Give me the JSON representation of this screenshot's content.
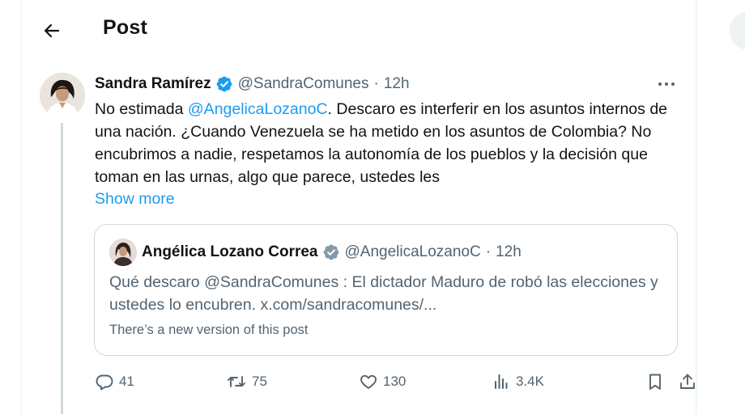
{
  "header": {
    "title": "Post"
  },
  "post": {
    "author_name": "Sandra Ramírez",
    "handle": "@SandraComunes",
    "separator": "·",
    "time": "12h",
    "text_before_mention": "No estimada ",
    "mention": "@AngelicaLozanoC",
    "text_after_mention": ". Descaro es interferir en los asuntos internos de una nación. ¿Cuando Venezuela se ha metido en los asuntos de Colombia? No encubrimos a nadie, respetamos la autonomía de los pueblos y la decisión que toman en las urnas, algo que parece, ustedes les",
    "show_more": "Show more"
  },
  "quote": {
    "author_name": "Angélica Lozano Correa",
    "handle": "@AngelicaLozanoC",
    "separator": "·",
    "time": "12h",
    "text": "Qué descaro @SandraComunes : El dictador Maduro de robó las elecciones y ustedes lo encubren. x.com/sandracomunes/...",
    "note": "There’s a new version of this post"
  },
  "actions": {
    "replies": "41",
    "reposts": "75",
    "likes": "130",
    "views": "3.4K"
  },
  "colors": {
    "accent": "#1d9bf0",
    "verified_blue": "#1d9bf0",
    "verified_gray": "#829aab",
    "secondary_text": "#536471",
    "border": "#cfd9de"
  },
  "icons": {
    "back": "arrow-left-icon",
    "more": "ellipsis-icon",
    "verified": "verified-badge-icon",
    "reply": "reply-icon",
    "repost": "repost-icon",
    "like": "heart-icon",
    "views": "views-icon",
    "bookmark": "bookmark-icon",
    "share": "share-icon"
  }
}
